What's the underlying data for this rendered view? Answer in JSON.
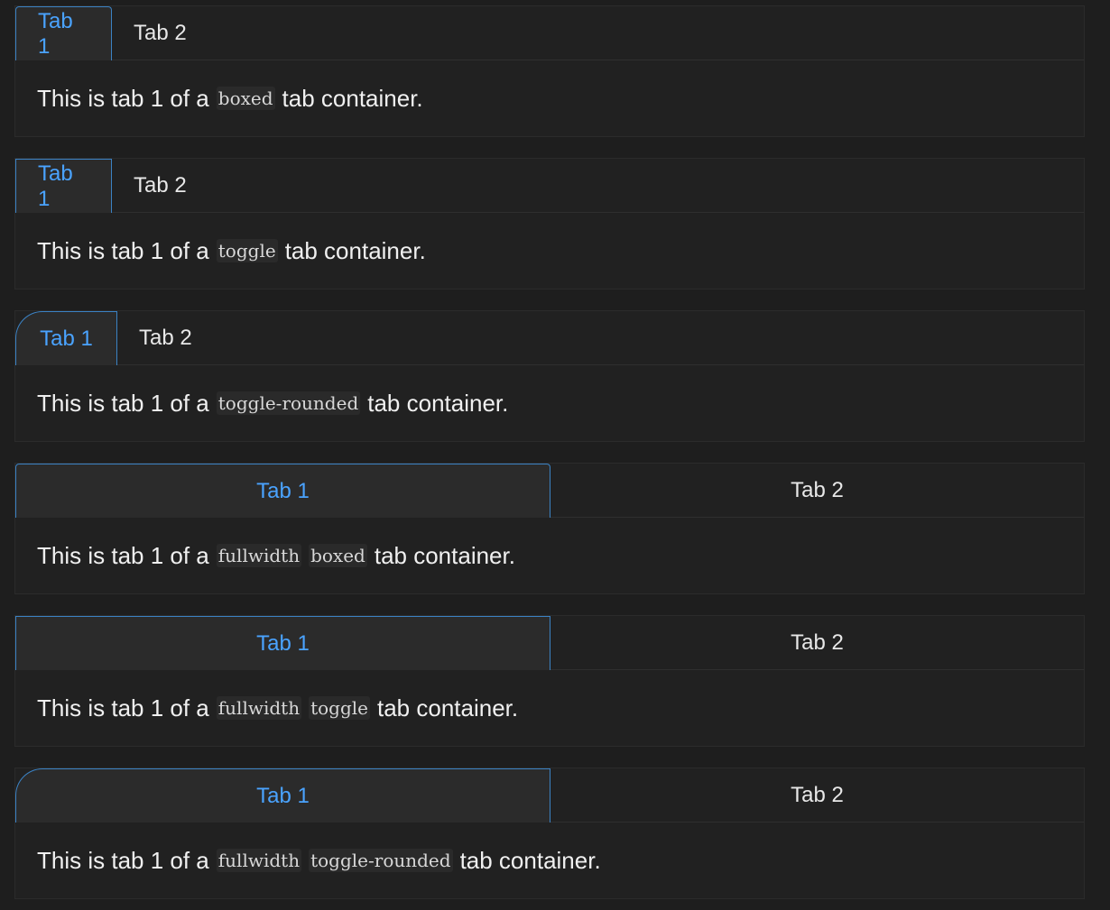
{
  "containers": [
    {
      "tabs": [
        "Tab 1",
        "Tab 2"
      ],
      "text_before": "This is tab 1 of a",
      "codes": [
        "boxed"
      ],
      "text_after": "tab container."
    },
    {
      "tabs": [
        "Tab 1",
        "Tab 2"
      ],
      "text_before": "This is tab 1 of a",
      "codes": [
        "toggle"
      ],
      "text_after": "tab container."
    },
    {
      "tabs": [
        "Tab 1",
        "Tab 2"
      ],
      "text_before": "This is tab 1 of a",
      "codes": [
        "toggle-rounded"
      ],
      "text_after": "tab container."
    },
    {
      "tabs": [
        "Tab 1",
        "Tab 2"
      ],
      "text_before": "This is tab 1 of a",
      "codes": [
        "fullwidth",
        "boxed"
      ],
      "text_after": "tab container."
    },
    {
      "tabs": [
        "Tab 1",
        "Tab 2"
      ],
      "text_before": "This is tab 1 of a",
      "codes": [
        "fullwidth",
        "toggle"
      ],
      "text_after": "tab container."
    },
    {
      "tabs": [
        "Tab 1",
        "Tab 2"
      ],
      "text_before": "This is tab 1 of a",
      "codes": [
        "fullwidth",
        "toggle-rounded"
      ],
      "text_after": "tab container."
    }
  ],
  "colors": {
    "background": "#1e1e1e",
    "active_tab_text": "#4aa3ff",
    "active_tab_border": "#3b82c4"
  }
}
